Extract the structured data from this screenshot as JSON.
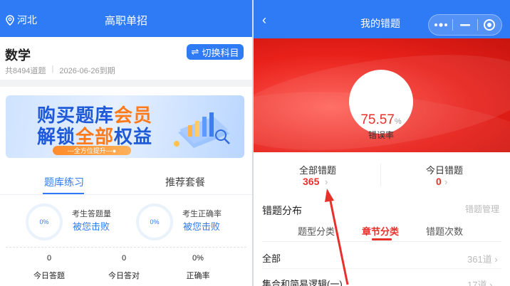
{
  "left": {
    "location": "河北",
    "title": "高职单招",
    "subject": "数学",
    "switch_label": "切换科目",
    "meta_count": "共8494道题",
    "meta_date": "2026-06-26到期",
    "banner": {
      "line1a": "购买",
      "line1b": "题库",
      "line1c": "会员",
      "line2a": "解锁",
      "line2b": "全部",
      "line2c": "权益",
      "pill": "---全方位提升---●"
    },
    "tabs": [
      "题库练习",
      "推荐套餐"
    ],
    "stats": [
      {
        "ring": "0%",
        "label": "考生答题量",
        "link": "被您击败"
      },
      {
        "ring": "0%",
        "label": "考生正确率",
        "link": "被您击败"
      }
    ],
    "bottom": [
      {
        "value": "0",
        "label": "今日答题"
      },
      {
        "value": "0",
        "label": "今日答对"
      },
      {
        "value": "0%",
        "label": "正确率"
      }
    ]
  },
  "right": {
    "title": "我的错题",
    "error_rate": "75.57",
    "error_rate_unit": "%",
    "error_rate_label": "错误率",
    "summary": [
      {
        "label": "全部错题",
        "value": "365"
      },
      {
        "label": "今日错题",
        "value": "0"
      }
    ],
    "section_title": "错题分布",
    "manage": "错题管理",
    "tabs": [
      "题型分类",
      "章节分类",
      "错题次数"
    ],
    "rows": [
      {
        "label": "全部",
        "value": "361道"
      },
      {
        "label": "集合和简易逻辑(一)",
        "value": "17道"
      }
    ]
  },
  "colors": {
    "primary_blue": "#2f7bf5",
    "accent_red": "#e8302a",
    "hero_red": "#e8201a",
    "annotation_arrow": "#e8302a"
  }
}
